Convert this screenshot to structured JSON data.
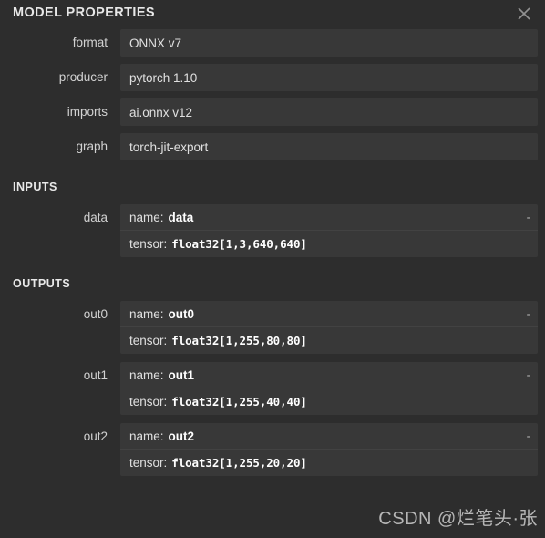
{
  "panel": {
    "title": "MODEL PROPERTIES",
    "close_icon": "close-icon",
    "bg_color": "#2d2d2d",
    "field_color": "#383838",
    "text_color": "#e0e0e0"
  },
  "properties": [
    {
      "label": "format",
      "value": "ONNX v7"
    },
    {
      "label": "producer",
      "value": "pytorch 1.10"
    },
    {
      "label": "imports",
      "value": "ai.onnx v12"
    },
    {
      "label": "graph",
      "value": "torch-jit-export"
    }
  ],
  "inputs": {
    "heading": "INPUTS",
    "items": [
      {
        "label": "data",
        "name_key": "name:",
        "name_value": "data",
        "tensor_key": "tensor:",
        "tensor_value": "float32[1,3,640,640]",
        "trailing": "-"
      }
    ]
  },
  "outputs": {
    "heading": "OUTPUTS",
    "items": [
      {
        "label": "out0",
        "name_key": "name:",
        "name_value": "out0",
        "tensor_key": "tensor:",
        "tensor_value": "float32[1,255,80,80]",
        "trailing": "-"
      },
      {
        "label": "out1",
        "name_key": "name:",
        "name_value": "out1",
        "tensor_key": "tensor:",
        "tensor_value": "float32[1,255,40,40]",
        "trailing": "-"
      },
      {
        "label": "out2",
        "name_key": "name:",
        "name_value": "out2",
        "tensor_key": "tensor:",
        "tensor_value": "float32[1,255,20,20]",
        "trailing": "-"
      }
    ]
  },
  "watermark": {
    "text": "CSDN @烂笔头·张"
  }
}
